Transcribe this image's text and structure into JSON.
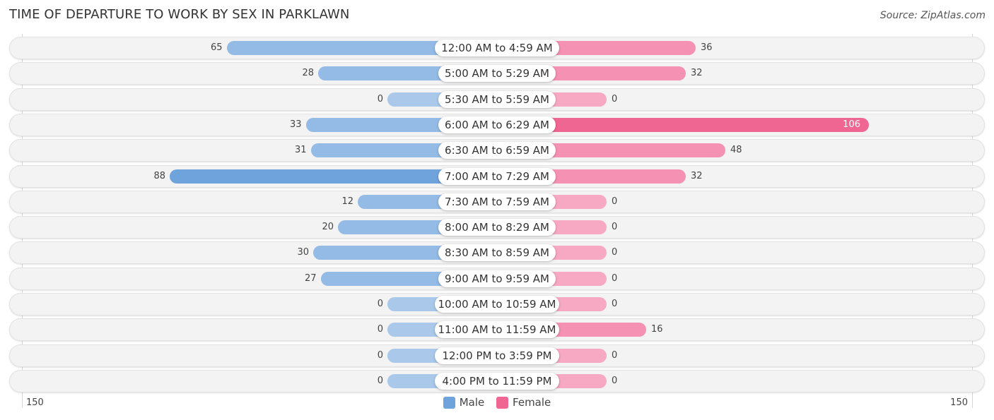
{
  "title": "TIME OF DEPARTURE TO WORK BY SEX IN PARKLAWN",
  "source": "Source: ZipAtlas.com",
  "colors": {
    "male": "#6fa3dc",
    "male_light": "#a9c8ea",
    "female": "#f06693",
    "female_light": "#f7a8c2"
  },
  "chart_data": {
    "type": "bar",
    "orientation": "horizontal-diverging",
    "title": "TIME OF DEPARTURE TO WORK BY SEX IN PARKLAWN",
    "categories": [
      "12:00 AM to 4:59 AM",
      "5:00 AM to 5:29 AM",
      "5:30 AM to 5:59 AM",
      "6:00 AM to 6:29 AM",
      "6:30 AM to 6:59 AM",
      "7:00 AM to 7:29 AM",
      "7:30 AM to 7:59 AM",
      "8:00 AM to 8:29 AM",
      "8:30 AM to 8:59 AM",
      "9:00 AM to 9:59 AM",
      "10:00 AM to 10:59 AM",
      "11:00 AM to 11:59 AM",
      "12:00 PM to 3:59 PM",
      "4:00 PM to 11:59 PM"
    ],
    "series": [
      {
        "name": "Male",
        "values": [
          65,
          28,
          0,
          33,
          31,
          88,
          12,
          20,
          30,
          27,
          0,
          0,
          0,
          0
        ]
      },
      {
        "name": "Female",
        "values": [
          36,
          32,
          0,
          106,
          48,
          32,
          0,
          0,
          0,
          0,
          0,
          16,
          0,
          0
        ]
      }
    ],
    "axis": {
      "left_label": "150",
      "right_label": "150",
      "range": [
        -150,
        150
      ]
    },
    "legend": {
      "position": "bottom-center",
      "entries": [
        "Male",
        "Female"
      ]
    },
    "grid": false
  }
}
